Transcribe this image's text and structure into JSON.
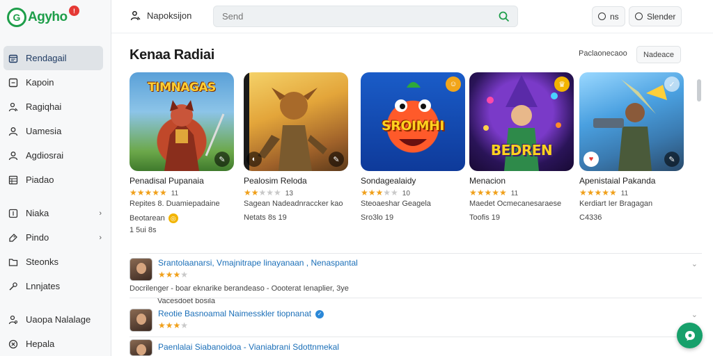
{
  "app": {
    "logo_text": "Agyho",
    "logo_mark": "G",
    "logo_badge": "!"
  },
  "sidebar": {
    "items": [
      {
        "label": "Rendagail",
        "icon": "calendar-icon"
      },
      {
        "label": "Kapoin",
        "icon": "square-icon"
      },
      {
        "label": "Ragiqhai",
        "icon": "person-icon"
      },
      {
        "label": "Uamesia",
        "icon": "user-icon"
      },
      {
        "label": "Agdiosrai",
        "icon": "user-icon"
      },
      {
        "label": "Piadao",
        "icon": "grid-icon"
      },
      {
        "label": "Niaka",
        "icon": "info-icon"
      },
      {
        "label": "Pindo",
        "icon": "tag-icon"
      },
      {
        "label": "Steonks",
        "icon": "folder-icon"
      },
      {
        "label": "Lnnjates",
        "icon": "tool-icon"
      },
      {
        "label": "Uaopa Nalalage",
        "icon": "person-icon"
      },
      {
        "label": "Hepala",
        "icon": "close-icon"
      }
    ]
  },
  "topbar": {
    "title": "Napoksijon",
    "search_placeholder": "Send",
    "btn1_label": "ns",
    "btn2_label": "Slender"
  },
  "section": {
    "title": "Kenaa Radiai",
    "meta": "Paclaonecaoo",
    "button_label": "Nadeace"
  },
  "cards": [
    {
      "art_title": "TIMNAGAS",
      "name": "Penadisal Pupanaia",
      "rating": 5,
      "count": "11",
      "sub": "Repites  8. Duamiepadaine",
      "extra": "Beotarean",
      "extra2": "1 5ui 8s"
    },
    {
      "art_title": "",
      "name": "Pealosim Reloda",
      "rating": 2,
      "count": "13",
      "sub": "Sagean  Nadeadnraccker kao",
      "extra": "Netats 8s 19",
      "extra2": ""
    },
    {
      "art_title": "SROIMHI",
      "name": "Sondagealaidy",
      "rating": 3,
      "count": "10",
      "sub": "Steoaeshar  Geagela",
      "extra": "Sro3lo 19",
      "extra2": ""
    },
    {
      "art_title": "BEDREN",
      "name": "Menacion",
      "rating": 5,
      "count": "11",
      "sub": "Maedet  Ocmecanesaraese",
      "extra": "Toofis 19",
      "extra2": ""
    },
    {
      "art_title": "",
      "name": "Apenistaial Pakanda",
      "rating": 5,
      "count": "11",
      "sub": "Kerdiart  Ier Bragagan",
      "extra": "C4336",
      "extra2": ""
    }
  ],
  "reviews": [
    {
      "title": "Srantolaanarsi, Vmajnitrape  linayanaan , Nenaspantal",
      "rating": 3,
      "body": "Docrilenger  -  boar eknarike berandeaso  -  Oooterat Ienaplier, 3ye",
      "foot": "Vacesdoet bosila",
      "verified": false
    },
    {
      "title": "Reotie Basnoamal  Naimesskler tiopnanat",
      "rating": 3,
      "body": "",
      "foot": "",
      "verified": true
    },
    {
      "title": "Paenlalai  Siabanoidoa  -  Vianiabrani  Sdottnmekal",
      "rating": 0,
      "body": "",
      "foot": "",
      "verified": false
    }
  ],
  "colors": {
    "accent": "#1e9e4a",
    "link": "#1b6fb8",
    "star": "#f0a01a",
    "fab": "#17a06b"
  }
}
